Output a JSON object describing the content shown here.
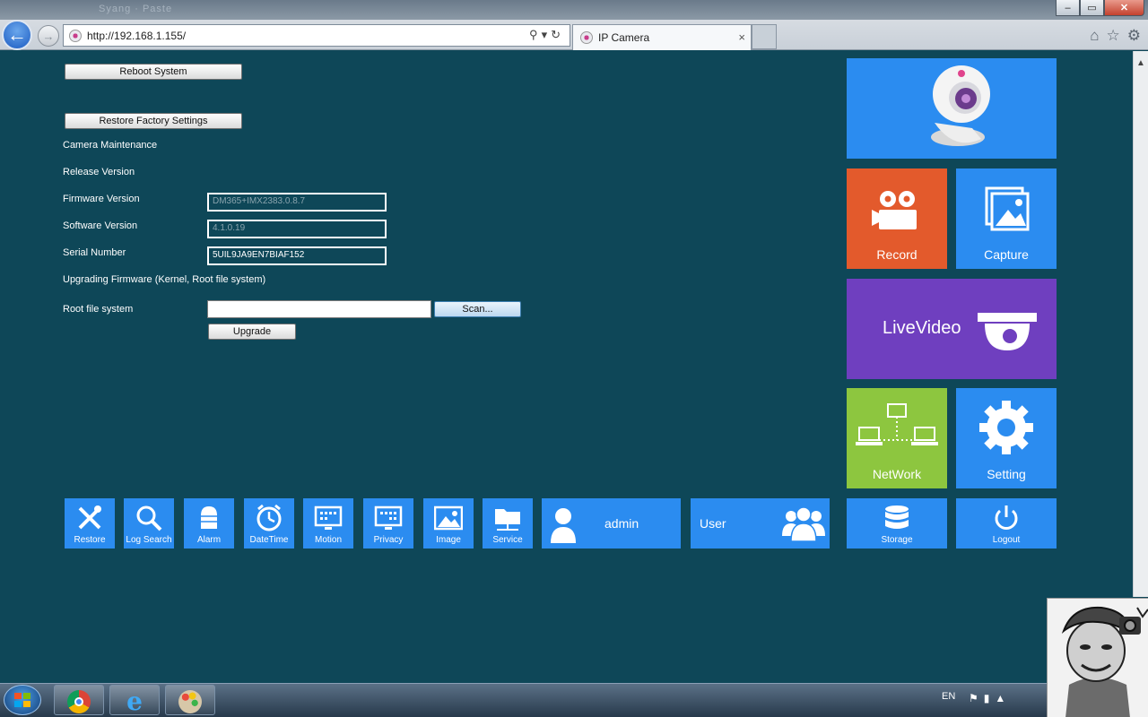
{
  "browser": {
    "address": "http://192.168.1.155/",
    "tab_title": "IP Camera",
    "tab_close": "×",
    "ghost_title": "Syang · Paste",
    "window_min": "–",
    "window_max": "▭",
    "window_close": "✕"
  },
  "form": {
    "reboot_button": "Reboot System",
    "restore_factory_button": "Restore Factory Settings",
    "camera_maintenance_label": "Camera Maintenance",
    "release_version_label": "Release Version",
    "firmware_version_label": "Firmware Version",
    "firmware_version_value": "DM365+IMX2383.0.8.7",
    "software_version_label": "Software Version",
    "software_version_value": "4.1.0.19",
    "serial_number_label": "Serial Number",
    "serial_number_value": "5UIL9JA9EN7BIAF152",
    "upgrading_label": "Upgrading Firmware (Kernel, Root file system)",
    "root_fs_label": "Root file system",
    "root_fs_value": "",
    "scan_button": "Scan...",
    "upgrade_button": "Upgrade"
  },
  "tiles": {
    "record": "Record",
    "capture": "Capture",
    "livevideo": "LiveVideo",
    "network": "NetWork",
    "setting": "Setting"
  },
  "bottom_tiles": {
    "restore": "Restore",
    "log_search": "Log Search",
    "alarm": "Alarm",
    "datetime": "DateTime",
    "motion": "Motion",
    "privacy": "Privacy",
    "image": "Image",
    "service": "Service",
    "admin": "admin",
    "user": "User",
    "storage": "Storage",
    "logout": "Logout"
  },
  "taskbar": {
    "language": "EN"
  },
  "colors": {
    "background": "#0e4758",
    "tile_blue": "#2b8cf0",
    "tile_orange": "#e35a2c",
    "tile_purple": "#6f3fbf",
    "tile_green": "#8dc63f"
  }
}
